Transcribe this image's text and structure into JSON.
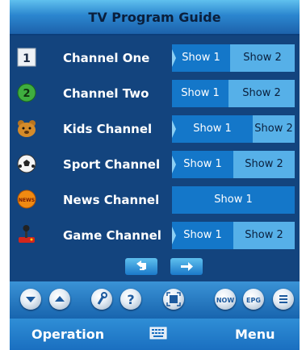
{
  "header": {
    "title": "TV Program Guide"
  },
  "channels": [
    {
      "name": "Channel One",
      "icon": "number-one-icon",
      "shows": [
        "Show 1",
        "Show 2"
      ]
    },
    {
      "name": "Channel Two",
      "icon": "number-two-icon",
      "shows": [
        "Show 1",
        "Show 2"
      ]
    },
    {
      "name": "Kids Channel",
      "icon": "bear-icon",
      "shows": [
        "Show 1",
        "Show 2"
      ]
    },
    {
      "name": "Sport Channel",
      "icon": "soccer-ball-icon",
      "shows": [
        "Show 1",
        "Show 2"
      ]
    },
    {
      "name": "News Channel",
      "icon": "news-icon",
      "shows": [
        "Show 1"
      ]
    },
    {
      "name": "Game Channel",
      "icon": "joystick-icon",
      "shows": [
        "Show 1",
        "Show 2"
      ]
    }
  ],
  "toolbar": {
    "now_label": "NOW",
    "epg_label": "EPG"
  },
  "bottom": {
    "left": "Operation",
    "right": "Menu"
  },
  "colors": {
    "panel": "#13447e",
    "show_dark": "#1477c9",
    "show_light": "#56b0e8"
  }
}
